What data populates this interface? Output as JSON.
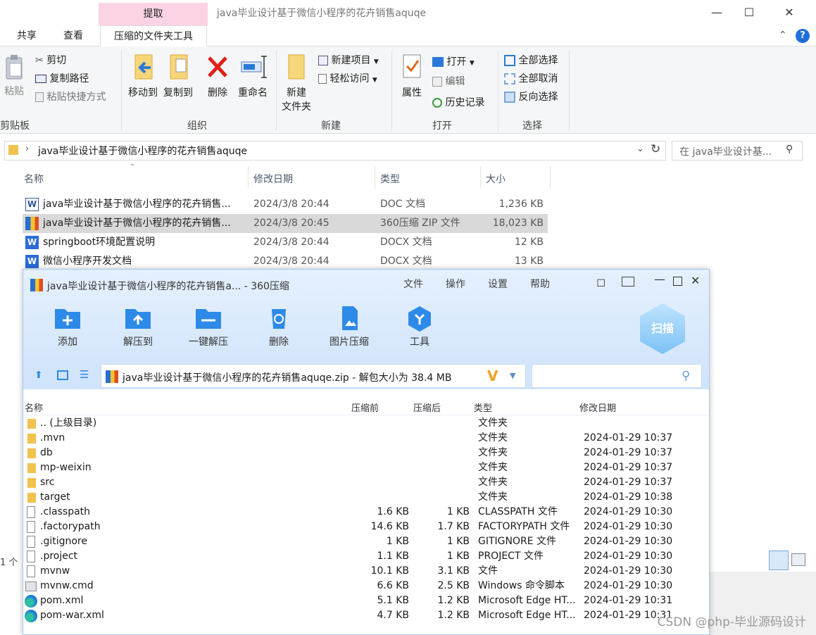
{
  "explorer": {
    "extract_tab": "提取",
    "title": "java毕业设计基于微信小程序的花卉销售aquqe",
    "tabs": [
      "共享",
      "查看",
      "压缩的文件夹工具"
    ],
    "clipboard": {
      "paste": "粘贴",
      "cut": "剪切",
      "copy_path": "复制路径",
      "paste_shortcut": "粘贴快捷方式",
      "label": "剪贴板"
    },
    "organize": {
      "move_to": "移动到",
      "copy_to": "复制到",
      "delete": "删除",
      "rename": "重命名",
      "label": "组织"
    },
    "new": {
      "new_folder_1": "新建",
      "new_folder_2": "文件夹",
      "new_item": "新建项目",
      "easy_access": "轻松访问",
      "label": "新建"
    },
    "open": {
      "properties": "属性",
      "open": "打开",
      "edit": "编辑",
      "history": "历史记录",
      "label": "打开"
    },
    "select": {
      "select_all": "全部选择",
      "select_none": "全部取消",
      "invert": "反向选择",
      "label": "选择"
    },
    "address": "java毕业设计基于微信小程序的花卉销售aquqe",
    "search_placeholder": "在 java毕业设计基...",
    "columns": {
      "name": "名称",
      "date": "修改日期",
      "type": "类型",
      "size": "大小"
    },
    "files": [
      {
        "name": "java毕业设计基于微信小程序的花卉销售...",
        "date": "2024/3/8 20:44",
        "type": "DOC 文档",
        "size": "1,236 KB",
        "icon": "word-doc-icon"
      },
      {
        "name": "java毕业设计基于微信小程序的花卉销售...",
        "date": "2024/3/8 20:45",
        "type": "360压缩 ZIP 文件",
        "size": "18,023 KB",
        "icon": "zip-icon"
      },
      {
        "name": "springboot环境配置说明",
        "date": "2024/3/8 20:44",
        "type": "DOCX 文档",
        "size": "12 KB",
        "icon": "word-icon"
      },
      {
        "name": "微信小程序开发文档",
        "date": "2024/3/8 20:44",
        "type": "DOCX 文档",
        "size": "13 KB",
        "icon": "word-icon"
      }
    ],
    "status_partial": "1 个"
  },
  "zip": {
    "title": "java毕业设计基于微信小程序的花卉销售a... - 360压缩",
    "menu": [
      "文件",
      "操作",
      "设置",
      "帮助"
    ],
    "tools": [
      "添加",
      "解压到",
      "一键解压",
      "删除",
      "图片压缩",
      "工具"
    ],
    "scan": "扫描",
    "path": "java毕业设计基于微信小程序的花卉销售aquqe.zip - 解包大小为 38.4 MB",
    "columns": {
      "name": "名称",
      "before": "压缩前",
      "after": "压缩后",
      "type": "类型",
      "date": "修改日期"
    },
    "rows": [
      {
        "name": ".. (上级目录)",
        "before": "",
        "after": "",
        "type": "文件夹",
        "date": "",
        "icon": "folder"
      },
      {
        "name": ".mvn",
        "before": "",
        "after": "",
        "type": "文件夹",
        "date": "2024-01-29 10:37",
        "icon": "folder"
      },
      {
        "name": "db",
        "before": "",
        "after": "",
        "type": "文件夹",
        "date": "2024-01-29 10:37",
        "icon": "folder"
      },
      {
        "name": "mp-weixin",
        "before": "",
        "after": "",
        "type": "文件夹",
        "date": "2024-01-29 10:37",
        "icon": "folder"
      },
      {
        "name": "src",
        "before": "",
        "after": "",
        "type": "文件夹",
        "date": "2024-01-29 10:37",
        "icon": "folder"
      },
      {
        "name": "target",
        "before": "",
        "after": "",
        "type": "文件夹",
        "date": "2024-01-29 10:38",
        "icon": "folder"
      },
      {
        "name": ".classpath",
        "before": "1.6 KB",
        "after": "1 KB",
        "type": "CLASSPATH 文件",
        "date": "2024-01-29 10:30",
        "icon": "file"
      },
      {
        "name": ".factorypath",
        "before": "14.6 KB",
        "after": "1.7 KB",
        "type": "FACTORYPATH 文件",
        "date": "2024-01-29 10:30",
        "icon": "file"
      },
      {
        "name": ".gitignore",
        "before": "1 KB",
        "after": "1 KB",
        "type": "GITIGNORE 文件",
        "date": "2024-01-29 10:30",
        "icon": "file"
      },
      {
        "name": ".project",
        "before": "1.1 KB",
        "after": "1 KB",
        "type": "PROJECT 文件",
        "date": "2024-01-29 10:30",
        "icon": "file"
      },
      {
        "name": "mvnw",
        "before": "10.1 KB",
        "after": "3.1 KB",
        "type": "文件",
        "date": "2024-01-29 10:30",
        "icon": "file"
      },
      {
        "name": "mvnw.cmd",
        "before": "6.6 KB",
        "after": "2.5 KB",
        "type": "Windows 命令脚本",
        "date": "2024-01-29 10:30",
        "icon": "cmd"
      },
      {
        "name": "pom.xml",
        "before": "5.1 KB",
        "after": "1.2 KB",
        "type": "Microsoft Edge HT...",
        "date": "2024-01-29 10:31",
        "icon": "edge"
      },
      {
        "name": "pom-war.xml",
        "before": "4.7 KB",
        "after": "1.2 KB",
        "type": "Microsoft Edge HT...",
        "date": "2024-01-29 10:31",
        "icon": "edge"
      }
    ]
  },
  "watermark": "CSDN @php-毕业源码设计"
}
